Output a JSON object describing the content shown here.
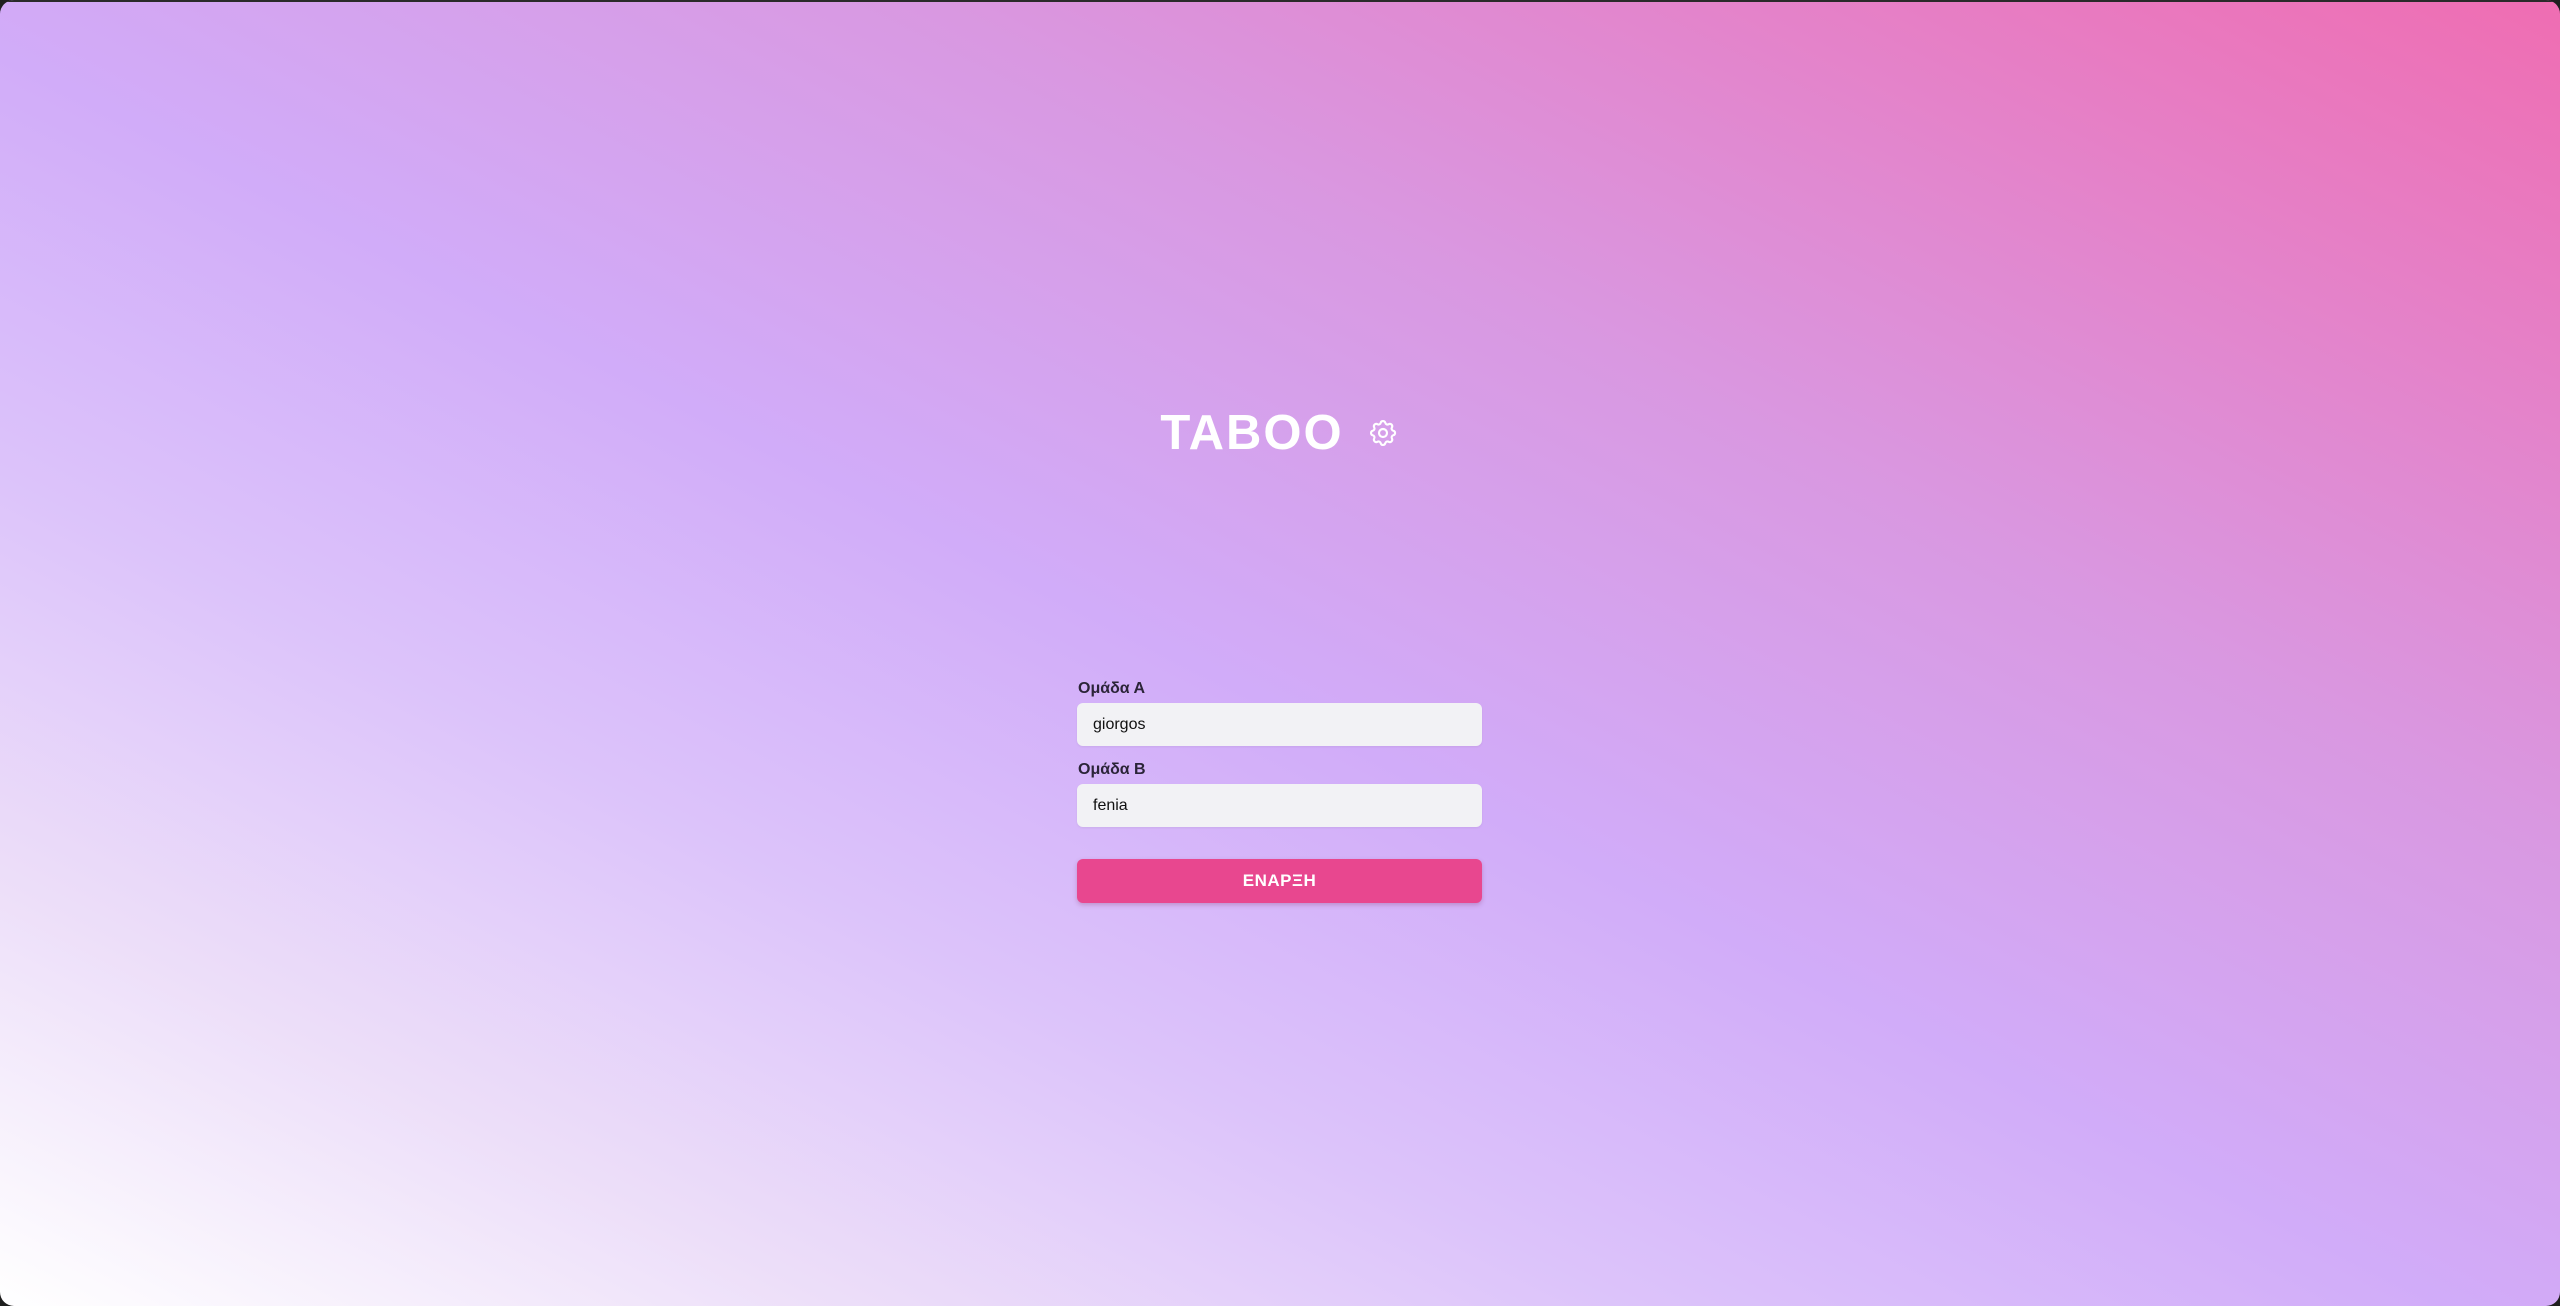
{
  "app": {
    "title": "TABOO",
    "settings_icon": "gear-icon"
  },
  "form": {
    "team_a": {
      "label": "Ομάδα Α",
      "value": "giorgos"
    },
    "team_b": {
      "label": "Ομάδα Β",
      "value": "fenia"
    },
    "start_label": "ΕΝΑΡΞΗ"
  },
  "colors": {
    "button": "#e8478f",
    "gradient_top_right": "#ef6eb2",
    "gradient_mid": "#d1acf9",
    "gradient_bottom_left": "#ffffff"
  }
}
